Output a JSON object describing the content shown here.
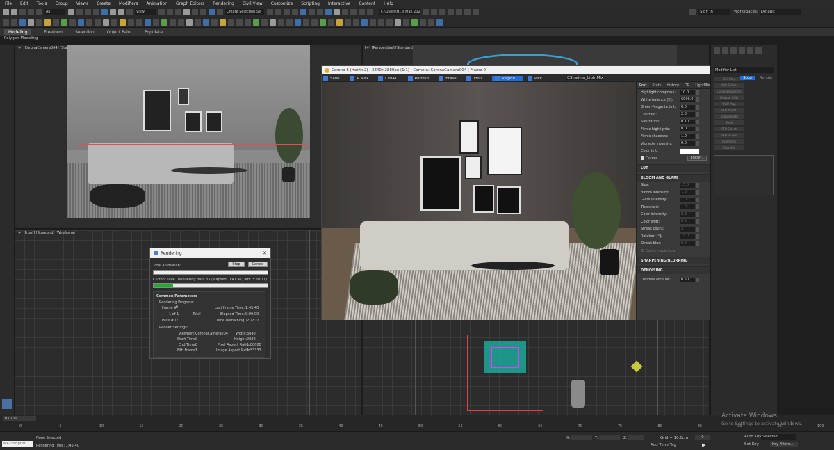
{
  "menu": [
    "File",
    "Edit",
    "Tools",
    "Group",
    "Views",
    "Create",
    "Modifiers",
    "Animation",
    "Graph Editors",
    "Rendering",
    "Civil View",
    "Customize",
    "Scripting",
    "Interactive",
    "Content",
    "Help"
  ],
  "toolbar": {
    "view_select": "All",
    "coord_select": "View",
    "selection_set": "Create Selection Se",
    "path": "C:\\Users\\H...s Max 2020",
    "sign_in": "Sign In",
    "workspaces_label": "Workspaces:",
    "workspaces_value": "Default"
  },
  "ribbon": {
    "tabs": [
      "Modeling",
      "Freeform",
      "Selection",
      "Object Paint",
      "Populate"
    ],
    "sub": "Polygon Modeling"
  },
  "viewports": {
    "top_left": "[+] [CoronaCamera004] [Standard] [Default Shading]",
    "top_right": "[+] [Perspective] [Standard] [Edged Faces]",
    "bottom_left": "[+] [Front] [Standard] [Wireframe]"
  },
  "corona": {
    "title": "Corona 6 (Hotfix 2) | 3840×2880px (1:1) | Camera: CoronaCamera004 | Frame 0",
    "toolbar": [
      "Save",
      "+ Max",
      "Ctrl+C",
      "Refresh",
      "Erase",
      "Tools",
      "Region",
      "Pick"
    ],
    "shading": "CShading_LightMix",
    "stop": "Stop",
    "render": "Render",
    "tabs": [
      "Post",
      "Stats",
      "History",
      "DR",
      "LightMix"
    ],
    "params": [
      {
        "label": "Highlight compress:",
        "value": "10.0"
      },
      {
        "label": "White balance [K]:",
        "value": "6000.0"
      },
      {
        "label": "Green-Magenta tint:",
        "value": "0.0"
      },
      {
        "label": "Contrast:",
        "value": "2.0"
      },
      {
        "label": "Saturation:",
        "value": "0.10"
      },
      {
        "label": "Filmic highlights:",
        "value": "0.0"
      },
      {
        "label": "Filmic shadows:",
        "value": "1.0"
      },
      {
        "label": "Vignette intensity:",
        "value": "0.0"
      },
      {
        "label": "Color tint:",
        "value": ""
      }
    ],
    "curves_label": "Curves",
    "editor_label": "Editor...",
    "lut": "LUT",
    "bloom_title": "BLOOM AND GLARE",
    "bloom": [
      {
        "label": "Size:",
        "value": "15.0"
      },
      {
        "label": "Bloom intensity:",
        "value": "1.0"
      },
      {
        "label": "Glare intensity:",
        "value": "1.0"
      },
      {
        "label": "Threshold:",
        "value": "1.0"
      },
      {
        "label": "Color intensity:",
        "value": "0.3"
      },
      {
        "label": "Color shift:",
        "value": "0.5"
      },
      {
        "label": "Streak count:",
        "value": "3"
      },
      {
        "label": "Rotation [°]:",
        "value": "15.0"
      },
      {
        "label": "Streak blur:",
        "value": "0.2"
      }
    ],
    "custom_aperture": "Custom aperture",
    "sharpen": "SHARPENING/BLURRING",
    "denoise": "DENOISING",
    "denoise_label": "Denoise amount:",
    "denoise_value": "0.50"
  },
  "render_dialog": {
    "title": "Rendering",
    "total_animation": "Total Animation:",
    "stop": "Stop",
    "cancel": "Cancel",
    "current_task_label": "Current Task:",
    "current_task": "Rendering pass 35 (elapsed: 0:41:47, left: 3:30:11)",
    "progress_total": 1.0,
    "progress_current": 0.17,
    "section": "Common Parameters",
    "rendering_progress": "Rendering Progress:",
    "frame": "Frame #",
    "frame_val": "0",
    "of": "1 of 1",
    "total": "Total",
    "pass": "Pass #",
    "pass_val": "1/1",
    "last_frame_label": "Last Frame Time:",
    "last_frame": "1:45:40",
    "elapsed_label": "Elapsed Time:",
    "elapsed": "0:00:00",
    "remaining_label": "Time Remaining:",
    "remaining": "??:??:??",
    "settings": "Render Settings:",
    "viewport_label": "Viewport:",
    "viewport": "CoronaCamera004",
    "width_label": "Width:",
    "width": "3840",
    "start_label": "Start Time:",
    "start": "0",
    "height_label": "Height:",
    "height": "2880",
    "end_label": "End Time:",
    "end": "0",
    "par_label": "Pixel Aspect Ratio:",
    "par": "1.00000",
    "nth_label": "Nth Frame:",
    "nth": "1",
    "iar_label": "Image Aspect Ratio:",
    "iar": "1.33333"
  },
  "command_panel": {
    "modifier_list": "Modifier List",
    "buttons": [
      "Edit Poly",
      "Edit Spline",
      "CoronaDisplacem",
      "Unwrap UVW",
      "UVW Map",
      "FFD 4x4x4",
      "Turbosmooth",
      "Shell",
      "FFD Select",
      "FFD 3x3x3",
      "Symmetry",
      "Chamfer"
    ]
  },
  "timeline": {
    "frame_indicator": "0 / 100",
    "ticks": [
      "0",
      "5",
      "10",
      "15",
      "20",
      "25",
      "30",
      "35",
      "40",
      "45",
      "50",
      "55",
      "60",
      "65",
      "70",
      "75",
      "80",
      "85",
      "90",
      "95",
      "100"
    ]
  },
  "status": {
    "maxscript": "MAXScript Mi",
    "selection": "None Selected",
    "render_time": "Rendering Time: 1:45:40",
    "x_label": "X:",
    "y_label": "Y:",
    "z_label": "Z:",
    "grid": "Grid = 10.0cm",
    "add_time_tag": "Add Time Tag",
    "auto_key": "Auto Key",
    "selected": "Selected",
    "set_key": "Set Key",
    "key_filters": "Key Filters...",
    "frame": "0"
  },
  "watermark": {
    "title": "Activate Windows",
    "sub": "Go to Settings to activate Windows."
  }
}
